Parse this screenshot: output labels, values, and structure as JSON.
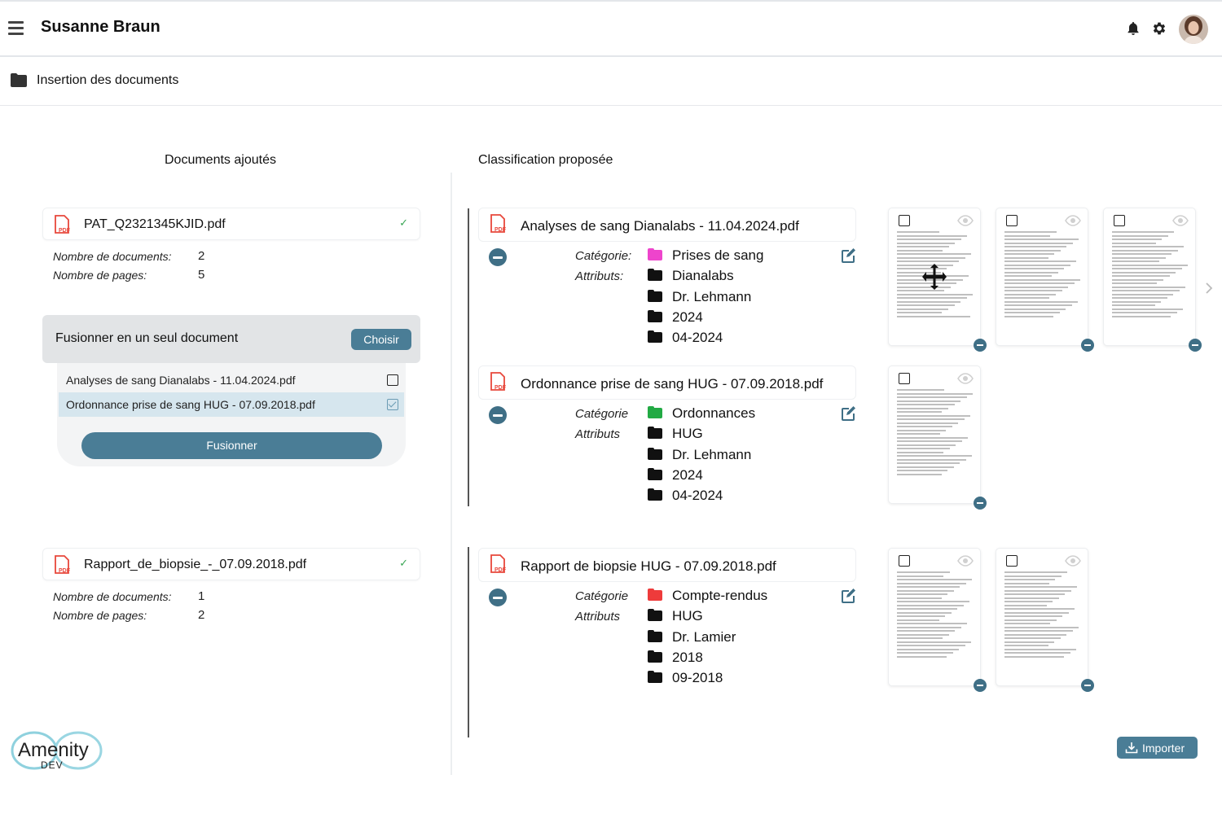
{
  "header": {
    "user_name": "Susanne Braun"
  },
  "page": {
    "title": "Insertion des documents"
  },
  "columns": {
    "left": "Documents ajoutés",
    "right": "Classification proposée"
  },
  "uploaded": [
    {
      "file": "PAT_Q2321345KJID.pdf",
      "docs_label": "Nombre de documents:",
      "docs": "2",
      "pages_label": "Nombre de pages:",
      "pages": "5"
    },
    {
      "file": "Rapport_de_biopsie_-_07.09.2018.pdf",
      "docs_label": "Nombre de documents:",
      "docs": "1",
      "pages_label": "Nombre de pages:",
      "pages": "2"
    }
  ],
  "merge": {
    "title": "Fusionner en un seul document",
    "choose_label": "Choisir",
    "items": [
      {
        "label": "Analyses de sang Dianalabs - 11.04.2024.pdf",
        "checked": false
      },
      {
        "label": "Ordonnance prise de sang HUG - 07.09.2018.pdf",
        "checked": true
      }
    ],
    "merge_button": "Fusionner"
  },
  "classification": [
    {
      "title": "Analyses de sang Dianalabs - 11.04.2024.pdf",
      "category_label": "Catégorie:",
      "attributes_label": "Attributs:",
      "category": "Prises de sang",
      "category_color": "#ee44cc",
      "attributes": [
        "Dianalabs",
        "Dr. Lehmann",
        "2024",
        "04-2024"
      ],
      "pages": 3
    },
    {
      "title": "Ordonnance prise de sang HUG - 07.09.2018.pdf",
      "category_label": "Catégorie",
      "attributes_label": "Attributs",
      "category": "Ordonnances",
      "category_color": "#22aa44",
      "attributes": [
        "HUG",
        "Dr. Lehmann",
        "2024",
        "04-2024"
      ],
      "pages": 1
    },
    {
      "title": "Rapport de biopsie HUG - 07.09.2018.pdf",
      "category_label": "Catégorie",
      "attributes_label": "Attributs",
      "category": "Compte-rendus",
      "category_color": "#ee3b3b",
      "attributes": [
        "HUG",
        "Dr. Lamier",
        "2018",
        "09-2018"
      ],
      "pages": 2
    }
  ],
  "import_button": "Importer",
  "logo": {
    "text": "Amenity",
    "sub": "DEV"
  },
  "colors": {
    "accent": "#4a7d96",
    "minus": "#3f6f86",
    "folder": "#111111",
    "pdf": "#e8473b"
  }
}
